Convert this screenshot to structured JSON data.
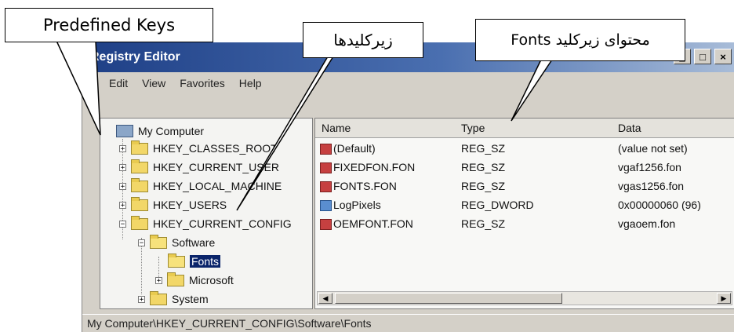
{
  "window": {
    "title": "Registry Editor",
    "buttons": [
      "_",
      "□",
      "×"
    ]
  },
  "menu": [
    "Edit",
    "View",
    "Favorites",
    "Help"
  ],
  "tree": {
    "root": "My Computer",
    "hives": [
      "HKEY_CLASSES_ROOT",
      "HKEY_CURRENT_USER",
      "HKEY_LOCAL_MACHINE",
      "HKEY_USERS",
      "HKEY_CURRENT_CONFIG"
    ],
    "expanded": {
      "software": "Software",
      "fonts": "Fonts",
      "microsoft": "Microsoft",
      "system": "System"
    }
  },
  "list": {
    "headers": [
      "Name",
      "Type",
      "Data"
    ],
    "rows": [
      {
        "name": "(Default)",
        "type": "REG_SZ",
        "data": "(value not set)",
        "icon": "string-value-icon"
      },
      {
        "name": "FIXEDFON.FON",
        "type": "REG_SZ",
        "data": "vgaf1256.fon",
        "icon": "string-value-icon"
      },
      {
        "name": "FONTS.FON",
        "type": "REG_SZ",
        "data": "vgas1256.fon",
        "icon": "string-value-icon"
      },
      {
        "name": "LogPixels",
        "type": "REG_DWORD",
        "data": "0x00000060 (96)",
        "icon": "binary-value-icon"
      },
      {
        "name": "OEMFONT.FON",
        "type": "REG_SZ",
        "data": "vgaoem.fon",
        "icon": "string-value-icon"
      }
    ]
  },
  "status": "My Computer\\HKEY_CURRENT_CONFIG\\Software\\Fonts",
  "callouts": {
    "predefined": "Predefined Keys",
    "subkeys": "زیرکلیدها",
    "fonts_content": "محتوای زیرکلید Fonts"
  },
  "colors": {
    "titlebar": "#1e3f86",
    "selection": "#0a246a",
    "window_bg": "#d4d0c8"
  }
}
